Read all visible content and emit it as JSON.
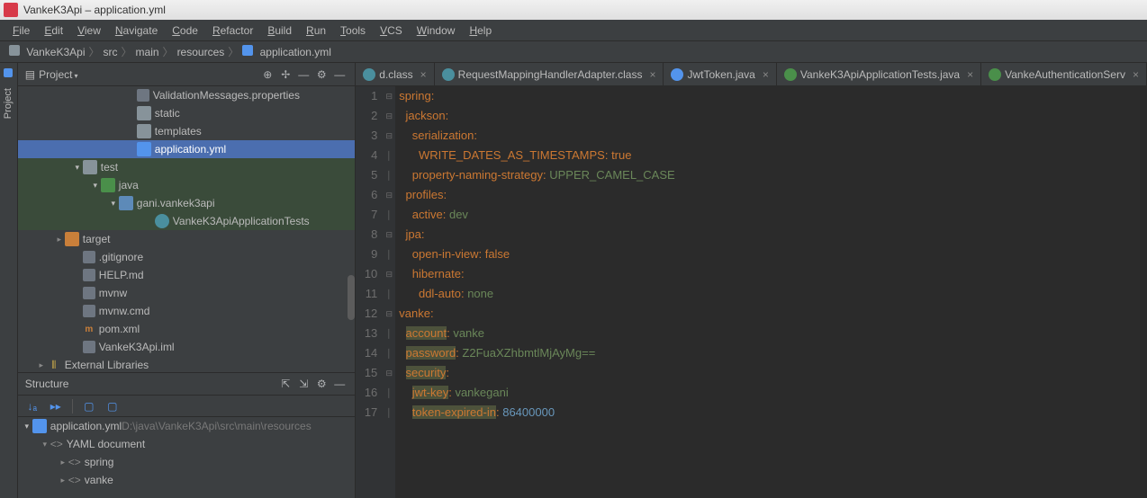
{
  "titlebar": {
    "text": "VankeK3Api – application.yml"
  },
  "menu": [
    "File",
    "Edit",
    "View",
    "Navigate",
    "Code",
    "Refactor",
    "Build",
    "Run",
    "Tools",
    "VCS",
    "Window",
    "Help"
  ],
  "breadcrumb": [
    "VankeK3Api",
    "src",
    "main",
    "resources",
    "application.yml"
  ],
  "project_panel": {
    "title": "Project",
    "items": [
      {
        "indent": 120,
        "icon": "props",
        "label": "ValidationMessages.properties"
      },
      {
        "indent": 120,
        "icon": "folder",
        "label": "static"
      },
      {
        "indent": 120,
        "icon": "folder",
        "label": "templates"
      },
      {
        "indent": 120,
        "icon": "yml",
        "label": "application.yml",
        "selected": true
      },
      {
        "indent": 60,
        "arrow": "open",
        "icon": "folder",
        "label": "test",
        "test": true
      },
      {
        "indent": 80,
        "arrow": "open",
        "icon": "folder-green",
        "label": "java",
        "test": true
      },
      {
        "indent": 100,
        "arrow": "open",
        "icon": "folder-blue",
        "label": "gani.vankek3api",
        "test": true
      },
      {
        "indent": 140,
        "icon": "java",
        "label": "VankeK3ApiApplicationTests",
        "test": true
      },
      {
        "indent": 40,
        "arrow": "closed",
        "icon": "folder-orange",
        "label": "target"
      },
      {
        "indent": 60,
        "icon": "file",
        "label": ".gitignore"
      },
      {
        "indent": 60,
        "icon": "file",
        "label": "HELP.md"
      },
      {
        "indent": 60,
        "icon": "file",
        "label": "mvnw"
      },
      {
        "indent": 60,
        "icon": "file",
        "label": "mvnw.cmd"
      },
      {
        "indent": 60,
        "icon": "maven",
        "label": "pom.xml"
      },
      {
        "indent": 60,
        "icon": "file",
        "label": "VankeK3Api.iml"
      },
      {
        "indent": 20,
        "arrow": "closed",
        "icon": "lib",
        "label": "External Libraries"
      }
    ]
  },
  "structure_panel": {
    "title": "Structure",
    "root": {
      "label": "application.yml",
      "path": "D:\\java\\VankeK3Api\\src\\main\\resources"
    },
    "items": [
      {
        "indent": 20,
        "arrow": "open",
        "label": "YAML document"
      },
      {
        "indent": 40,
        "arrow": "closed",
        "label": "spring"
      },
      {
        "indent": 40,
        "arrow": "closed",
        "label": "vanke"
      }
    ]
  },
  "tabs": [
    {
      "label": "d.class",
      "icon": "java"
    },
    {
      "label": "RequestMappingHandlerAdapter.class",
      "icon": "java"
    },
    {
      "label": "JwtToken.java",
      "icon": "java-blue"
    },
    {
      "label": "VankeK3ApiApplicationTests.java",
      "icon": "java-green"
    },
    {
      "label": "VankeAuthenticationServ",
      "icon": "java-green"
    }
  ],
  "code_lines": [
    {
      "n": 1,
      "key": "spring",
      "val": null,
      "indent": 0
    },
    {
      "n": 2,
      "key": "jackson",
      "val": null,
      "indent": 1
    },
    {
      "n": 3,
      "key": "serialization",
      "val": null,
      "indent": 2
    },
    {
      "n": 4,
      "key": "WRITE_DATES_AS_TIMESTAMPS",
      "val": "true",
      "vtype": "bool",
      "indent": 3
    },
    {
      "n": 5,
      "key": "property-naming-strategy",
      "val": "UPPER_CAMEL_CASE",
      "indent": 2
    },
    {
      "n": 6,
      "key": "profiles",
      "val": null,
      "indent": 1
    },
    {
      "n": 7,
      "key": "active",
      "val": "dev",
      "indent": 2
    },
    {
      "n": 8,
      "key": "jpa",
      "val": null,
      "indent": 1
    },
    {
      "n": 9,
      "key": "open-in-view",
      "val": "false",
      "vtype": "bool",
      "indent": 2
    },
    {
      "n": 10,
      "key": "hibernate",
      "val": null,
      "indent": 2
    },
    {
      "n": 11,
      "key": "ddl-auto",
      "val": "none",
      "indent": 3
    },
    {
      "n": 12,
      "key": "vanke",
      "val": null,
      "indent": 0
    },
    {
      "n": 13,
      "key": "account",
      "val": "vanke",
      "indent": 1,
      "hl": true
    },
    {
      "n": 14,
      "key": "password",
      "val": "Z2FuaXZhbmtlMjAyMg==",
      "indent": 1,
      "hl": true
    },
    {
      "n": 15,
      "key": "security",
      "val": null,
      "indent": 1,
      "hl": true
    },
    {
      "n": 16,
      "key": "jwt-key",
      "val": "vankegani",
      "indent": 2,
      "hl": true
    },
    {
      "n": 17,
      "key": "token-expired-in",
      "val": "86400000",
      "vtype": "num",
      "indent": 2,
      "hl": true
    }
  ],
  "sidebar_strip": {
    "label": "Project"
  }
}
